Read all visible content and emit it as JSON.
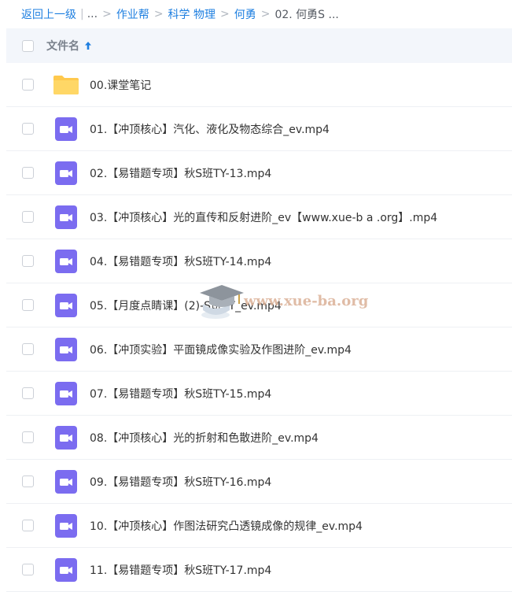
{
  "breadcrumb": {
    "back": "返回上一级",
    "ellipsis": "...",
    "crumbs": [
      "作业帮",
      "科学 物理",
      "何勇"
    ],
    "current": "02. 何勇S ..."
  },
  "header": {
    "name_label": "文件名"
  },
  "files": [
    {
      "type": "folder",
      "name": "00.课堂笔记"
    },
    {
      "type": "video",
      "name": "01.【冲顶核心】汽化、液化及物态综合_ev.mp4"
    },
    {
      "type": "video",
      "name": "02.【易错题专项】秋S班TY-13.mp4"
    },
    {
      "type": "video",
      "name": "03.【冲顶核心】光的直传和反射进阶_ev【www.xue-b a .org】.mp4"
    },
    {
      "type": "video",
      "name": "04.【易错题专项】秋S班TY-14.mp4"
    },
    {
      "type": "video",
      "name": "05.【月度点睛课】(2)-S班TY_ev.mp4"
    },
    {
      "type": "video",
      "name": "06.【冲顶实验】平面镜成像实验及作图进阶_ev.mp4"
    },
    {
      "type": "video",
      "name": "07.【易错题专项】秋S班TY-15.mp4"
    },
    {
      "type": "video",
      "name": "08.【冲顶核心】光的折射和色散进阶_ev.mp4"
    },
    {
      "type": "video",
      "name": "09.【易错题专项】秋S班TY-16.mp4"
    },
    {
      "type": "video",
      "name": "10.【冲顶核心】作图法研究凸透镜成像的规律_ev.mp4"
    },
    {
      "type": "video",
      "name": "11.【易错题专项】秋S班TY-17.mp4"
    }
  ],
  "watermark": {
    "text": "www.xue-ba.org"
  },
  "colors": {
    "link": "#1e7fe0",
    "folder": "#ffc94d",
    "video": "#7b6cf0",
    "header_bg": "#f3f6fb"
  },
  "icons": {
    "sort": "arrow-up-icon",
    "folder": "folder-icon",
    "video": "video-file-icon"
  }
}
